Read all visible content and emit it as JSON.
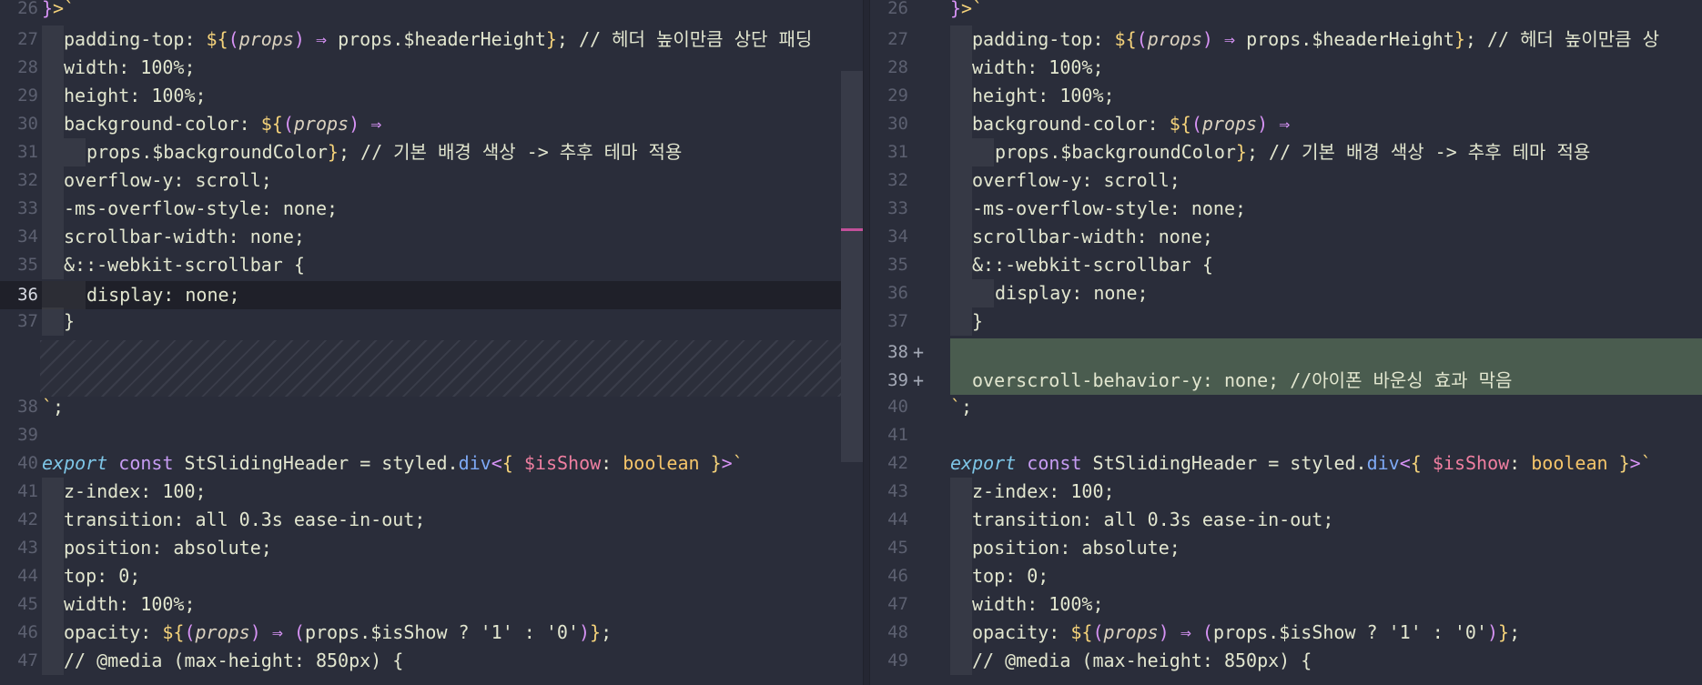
{
  "left": {
    "lines": [
      {
        "num": "26",
        "text": "}>`"
      },
      {
        "num": "27",
        "text": "padding-top: ${(props) ⇒ props.$headerHeight}; // 헤더 높이만큼 상단 패딩"
      },
      {
        "num": "28",
        "text": "width: 100%;"
      },
      {
        "num": "29",
        "text": "height: 100%;"
      },
      {
        "num": "30",
        "text": "background-color: ${(props) ⇒"
      },
      {
        "num": "31",
        "text": "props.$backgroundColor}; // 기본 배경 색상 -> 추후 테마 적용"
      },
      {
        "num": "32",
        "text": "overflow-y: scroll;"
      },
      {
        "num": "33",
        "text": "-ms-overflow-style: none;"
      },
      {
        "num": "34",
        "text": "scrollbar-width: none;"
      },
      {
        "num": "35",
        "text": "&::-webkit-scrollbar {"
      },
      {
        "num": "36",
        "text": "display: none;"
      },
      {
        "num": "37",
        "text": "}"
      },
      {
        "num": "38",
        "text": "`;"
      },
      {
        "num": "39",
        "text": ""
      },
      {
        "num": "40",
        "text": "export const StSlidingHeader = styled.div<{ $isShow: boolean }>`"
      },
      {
        "num": "41",
        "text": "z-index: 100;"
      },
      {
        "num": "42",
        "text": "transition: all 0.3s ease-in-out;"
      },
      {
        "num": "43",
        "text": "position: absolute;"
      },
      {
        "num": "44",
        "text": "top: 0;"
      },
      {
        "num": "45",
        "text": "width: 100%;"
      },
      {
        "num": "46",
        "text": "opacity: ${(props) ⇒ (props.$isShow ? '1' : '0')};"
      },
      {
        "num": "47",
        "text": "// @media (max-height: 850px) {"
      }
    ]
  },
  "right": {
    "lines": [
      {
        "num": "26",
        "text": "}>`"
      },
      {
        "num": "27",
        "text": "padding-top: ${(props) ⇒ props.$headerHeight}; // 헤더 높이만큼 상"
      },
      {
        "num": "28",
        "text": "width: 100%;"
      },
      {
        "num": "29",
        "text": "height: 100%;"
      },
      {
        "num": "30",
        "text": "background-color: ${(props) ⇒"
      },
      {
        "num": "31",
        "text": "props.$backgroundColor}; // 기본 배경 색상 -> 추후 테마 적용"
      },
      {
        "num": "32",
        "text": "overflow-y: scroll;"
      },
      {
        "num": "33",
        "text": "-ms-overflow-style: none;"
      },
      {
        "num": "34",
        "text": "scrollbar-width: none;"
      },
      {
        "num": "35",
        "text": "&::-webkit-scrollbar {"
      },
      {
        "num": "36",
        "text": "display: none;"
      },
      {
        "num": "37",
        "text": "}"
      },
      {
        "num": "38",
        "text": ""
      },
      {
        "num": "39",
        "text": "overscroll-behavior-y: none; //아이폰 바운싱 효과 막음"
      },
      {
        "num": "40",
        "text": "`;"
      },
      {
        "num": "41",
        "text": ""
      },
      {
        "num": "42",
        "text": "export const StSlidingHeader = styled.div<{ $isShow: boolean }>`"
      },
      {
        "num": "43",
        "text": "z-index: 100;"
      },
      {
        "num": "44",
        "text": "transition: all 0.3s ease-in-out;"
      },
      {
        "num": "45",
        "text": "position: absolute;"
      },
      {
        "num": "46",
        "text": "top: 0;"
      },
      {
        "num": "47",
        "text": "width: 100%;"
      },
      {
        "num": "48",
        "text": "opacity: ${(props) ⇒ (props.$isShow ? '1' : '0')};"
      },
      {
        "num": "49",
        "text": "// @media (max-height: 850px) {"
      }
    ],
    "added_marker": "+"
  },
  "colors": {
    "background": "#2a2d3a",
    "added_line": "#4a5c4f",
    "current_line": "#1f2029",
    "scroll_marker": "#c2509a"
  }
}
